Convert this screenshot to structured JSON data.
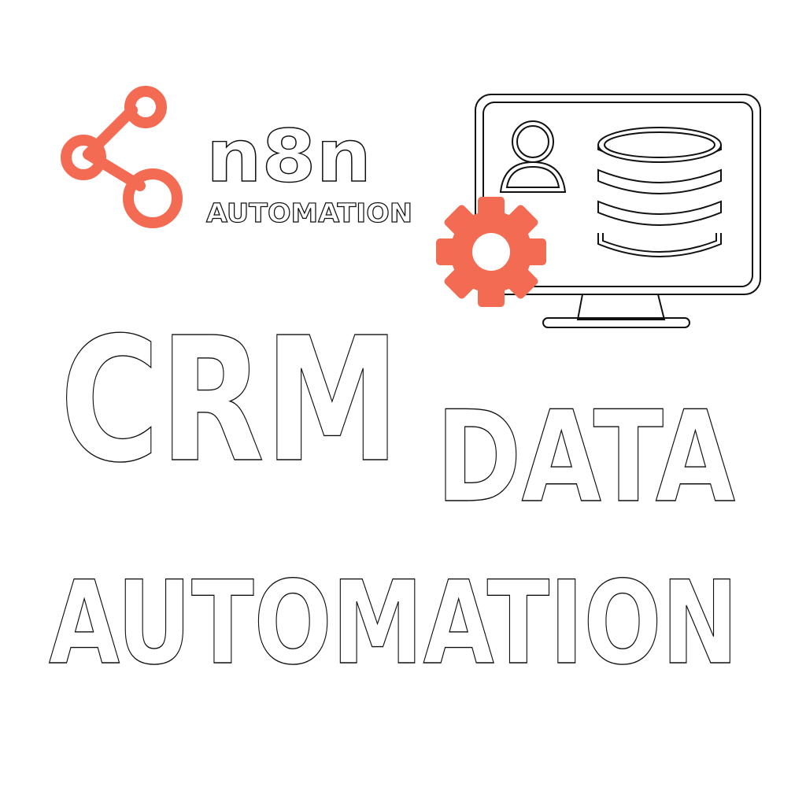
{
  "logo": {
    "wordmark": "n8n",
    "tagline": "AUTOMATION"
  },
  "headline": {
    "line1": "CRM",
    "line2": "DATA",
    "line3": "AUTOMATION"
  },
  "colors": {
    "accent": "#f26b52",
    "outline": "#111111",
    "background": "#ffffff"
  },
  "icons": [
    "n8n-node-icon",
    "gear-icon",
    "monitor-icon",
    "user-icon",
    "database-icon"
  ]
}
